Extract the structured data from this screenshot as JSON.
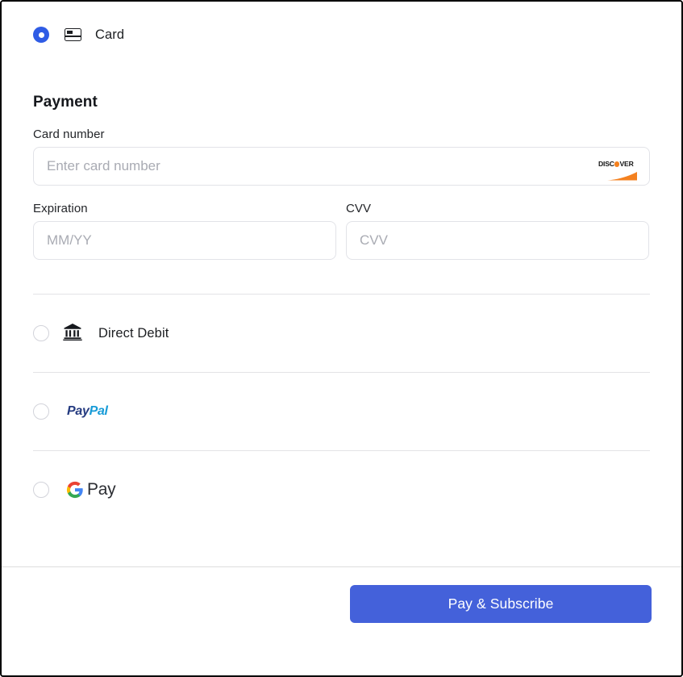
{
  "payment_methods": [
    {
      "id": "card",
      "label": "Card",
      "icon": "credit-card-icon",
      "selected": true
    },
    {
      "id": "direct-debit",
      "label": "Direct Debit",
      "icon": "bank-icon",
      "selected": false
    },
    {
      "id": "paypal",
      "label": "PayPal",
      "icon": "paypal-logo",
      "logo_parts": {
        "first": "Pay",
        "second": "Pal"
      },
      "selected": false
    },
    {
      "id": "google-pay",
      "label": "Pay",
      "icon": "google-g-logo",
      "selected": false
    }
  ],
  "card_form": {
    "section_title": "Payment",
    "card_number": {
      "label": "Card number",
      "placeholder": "Enter card number",
      "value": "",
      "brand": "DISCOVER",
      "brand_word_parts": {
        "before": "DISC",
        "after": "VER"
      }
    },
    "expiration": {
      "label": "Expiration",
      "placeholder": "MM/YY",
      "value": ""
    },
    "cvv": {
      "label": "CVV",
      "placeholder": "CVV",
      "value": ""
    }
  },
  "footer": {
    "submit_label": "Pay & Subscribe"
  },
  "colors": {
    "accent_blue": "#2f5ce5",
    "button_blue": "#4461da",
    "discover_orange": "#f48120",
    "paypal_dark": "#253b80",
    "paypal_light": "#179bd7",
    "google_blue": "#4285f4",
    "google_red": "#ea4335",
    "google_yellow": "#fbbc05",
    "google_green": "#34a853"
  }
}
